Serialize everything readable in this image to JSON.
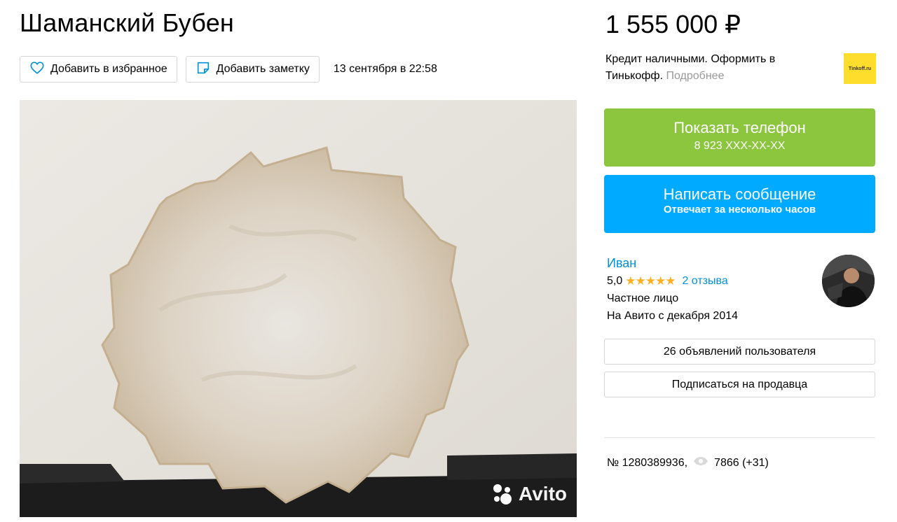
{
  "listing": {
    "title": "Шаманский Бубен",
    "price": "1 555 000 ₽",
    "date": "13 сентября в 22:58"
  },
  "actions": {
    "favorite_label": "Добавить в избранное",
    "note_label": "Добавить заметку"
  },
  "credit": {
    "text": "Кредит наличными. Оформить в Тинькофф.",
    "more": "Подробнее",
    "logo_text": "Tinkoff.ru"
  },
  "contact": {
    "phone_label": "Показать телефон",
    "phone_masked": "8 923 XXX-XX-XX",
    "message_label": "Написать сообщение",
    "message_sub": "Отвечает за несколько часов"
  },
  "seller": {
    "name": "Иван",
    "rating": "5,0",
    "stars": "★★★★★",
    "reviews": "2 отзыва",
    "type": "Частное лицо",
    "since": "На Авито с декабря 2014",
    "listings_button": "26 объявлений пользователя",
    "subscribe_button": "Подписаться на продавца"
  },
  "meta": {
    "number": "№ 1280389936,",
    "views": "7866 (+31)"
  },
  "photo": {
    "watermark": "Avito"
  },
  "colors": {
    "phone_button": "#8cc63f",
    "message_button": "#00aaff",
    "link": "#0091d9",
    "star": "#ffb021",
    "tinkoff": "#ffdd2d"
  },
  "icons": {
    "favorite": "heart-icon",
    "note": "note-icon",
    "views": "eye-icon"
  }
}
